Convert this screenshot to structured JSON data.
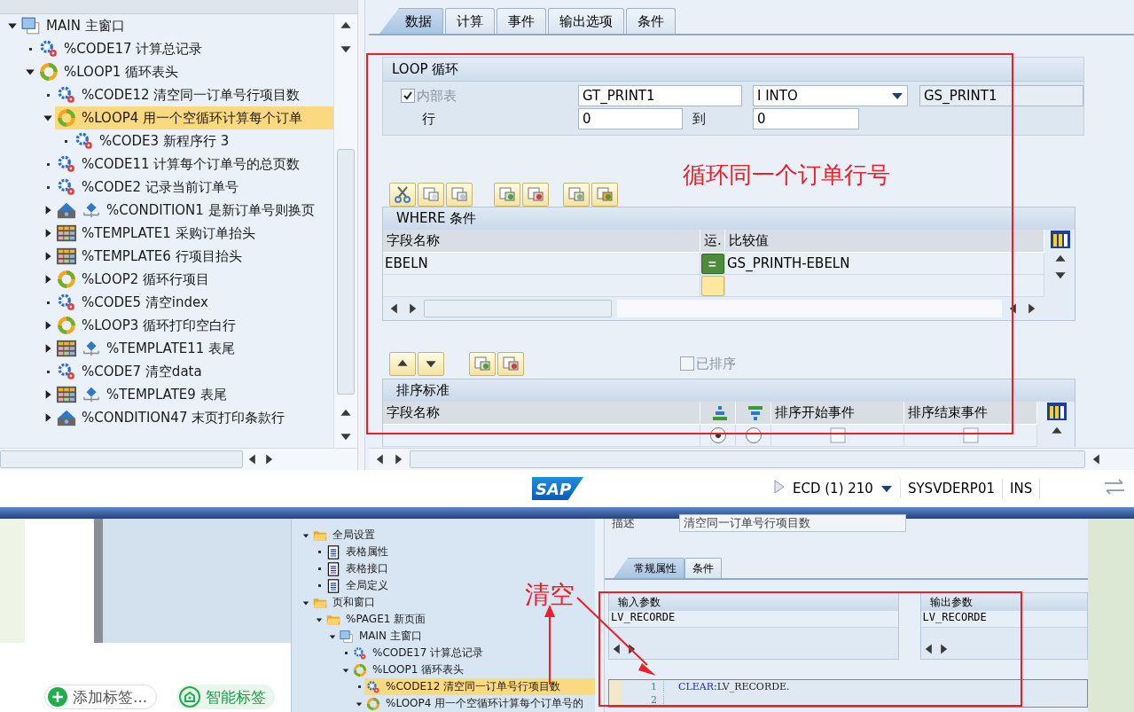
{
  "node_tree": {
    "items": [
      {
        "label": "MAIN 主窗口",
        "kind": "window",
        "expanded": true,
        "selected": false,
        "children": [
          {
            "label": "%CODE17 计算总记录",
            "kind": "code",
            "selected": false
          },
          {
            "label": "%LOOP1 循环表头",
            "kind": "loop",
            "expanded": true,
            "selected": false,
            "children": [
              {
                "label": "%CODE12 清空同一订单号行项目数",
                "kind": "code",
                "selected": false
              },
              {
                "label": "%LOOP4 用一个空循环计算每个订单",
                "kind": "loop",
                "expanded": true,
                "selected": true,
                "children": [
                  {
                    "label": "%CODE3 新程序行 3",
                    "kind": "code",
                    "selected": false
                  }
                ]
              },
              {
                "label": "%CODE11 计算每个订单号的总页数",
                "kind": "code",
                "selected": false
              },
              {
                "label": "%CODE2 记录当前订单号",
                "kind": "code",
                "selected": false
              },
              {
                "label": "%CONDITION1 是新订单号则换页",
                "kind": "condition_output",
                "expanded": false,
                "selected": false
              },
              {
                "label": "%TEMPLATE1 采购订单抬头",
                "kind": "template",
                "expanded": false,
                "selected": false
              },
              {
                "label": "%TEMPLATE6 行项目抬头",
                "kind": "template",
                "expanded": false,
                "selected": false
              },
              {
                "label": "%LOOP2 循环行项目",
                "kind": "loop",
                "expanded": false,
                "selected": false
              },
              {
                "label": "%CODE5 清空index",
                "kind": "code",
                "selected": false
              },
              {
                "label": "%LOOP3 循环打印空白行",
                "kind": "loop",
                "expanded": false,
                "selected": false
              },
              {
                "label": "%TEMPLATE11 表尾",
                "kind": "template_output",
                "expanded": false,
                "selected": false
              },
              {
                "label": "%CODE7 清空data",
                "kind": "code",
                "selected": false
              },
              {
                "label": "%TEMPLATE9 表尾",
                "kind": "template_output",
                "expanded": false,
                "selected": false
              },
              {
                "label": "%CONDITION47 末页打印条款行",
                "kind": "condition",
                "expanded": false,
                "selected": false
              }
            ]
          }
        ]
      }
    ]
  },
  "tabs": [
    {
      "label": "数据",
      "selected": true
    },
    {
      "label": "计算",
      "selected": false
    },
    {
      "label": "事件",
      "selected": false
    },
    {
      "label": "输出选项",
      "selected": false
    },
    {
      "label": "条件",
      "selected": false
    }
  ],
  "loop_group": {
    "title": "LOOP 循环",
    "internal_table": {
      "label": "内部表",
      "checked": true,
      "disabled": true
    },
    "table_field": "GT_PRINT1",
    "mode_select": "I INTO",
    "work_area_field": "GS_PRINT1",
    "row_label": "行",
    "row_from": "0",
    "to_label": "到",
    "row_to": "0"
  },
  "where_table": {
    "title": "WHERE 条件",
    "columns": [
      "字段名称",
      "运.",
      "比较值"
    ],
    "rows": [
      {
        "kind": "filled",
        "field": "EBELN",
        "operator": "=",
        "value": "GS_PRINTH-EBELN"
      },
      {
        "kind": "blank"
      }
    ]
  },
  "sorted_checkbox": {
    "label": "已排序",
    "checked": false,
    "disabled": true
  },
  "sort_table": {
    "title": "排序标准",
    "columns": [
      "字段名称",
      "排序开始事件",
      "排序结束事件"
    ],
    "rows": [
      {
        "ascending": true,
        "start_event": false,
        "end_event": false
      }
    ]
  },
  "status_bar": {
    "logo": "SAP",
    "system": "ECD (1) 210",
    "server": "SYSVDERP01",
    "mode": "INS"
  },
  "tags": [
    {
      "label": "添加标签...",
      "kind": "add"
    },
    {
      "label": "智能标签",
      "kind": "smart"
    }
  ],
  "form_tree": {
    "items": [
      {
        "label": "全局设置",
        "kind": "folder",
        "expanded": true,
        "selected": false,
        "children": [
          {
            "label": "表格属性",
            "kind": "document",
            "selected": false
          },
          {
            "label": "表格接口",
            "kind": "document",
            "selected": false
          },
          {
            "label": "全局定义",
            "kind": "document",
            "selected": false
          }
        ]
      },
      {
        "label": "页和窗口",
        "kind": "folder",
        "expanded": true,
        "selected": false,
        "children": [
          {
            "label": "%PAGE1 新页面",
            "kind": "folder",
            "expanded": true,
            "selected": false,
            "children": [
              {
                "label": "MAIN 主窗口",
                "kind": "window",
                "expanded": true,
                "selected": false,
                "children": [
                  {
                    "label": "%CODE17 计算总记录",
                    "kind": "code",
                    "selected": false
                  },
                  {
                    "label": "%LOOP1 循环表头",
                    "kind": "loop",
                    "expanded": true,
                    "selected": false,
                    "children": [
                      {
                        "label": "%CODE12 清空同一订单号行项目数",
                        "kind": "code",
                        "selected": true
                      },
                      {
                        "label": "%LOOP4 用一个空循环计算每个订单号的",
                        "kind": "loop",
                        "expanded": true,
                        "selected": false
                      }
                    ]
                  }
                ]
              }
            ]
          }
        ]
      }
    ]
  },
  "code_node": {
    "description_label": "描述",
    "description": "清空同一订单号行项目数",
    "tabs": [
      {
        "label": "常规属性",
        "selected": true
      },
      {
        "label": "条件",
        "selected": false
      }
    ],
    "input_params": {
      "title": "输入参数",
      "rows": [
        "LV_RECORDE"
      ]
    },
    "output_params": {
      "title": "输出参数",
      "rows": [
        "LV_RECORDE"
      ]
    },
    "code_lines": [
      {
        "number": "1",
        "tokens": [
          {
            "kind": "keyword",
            "text": "CLEAR"
          },
          {
            "kind": "plain",
            "text": ":LV_RECORDE."
          }
        ]
      },
      {
        "number": "2"
      }
    ]
  },
  "annotations": [
    {
      "text": "循环同一个订单行号"
    },
    {
      "text": "清空"
    }
  ]
}
